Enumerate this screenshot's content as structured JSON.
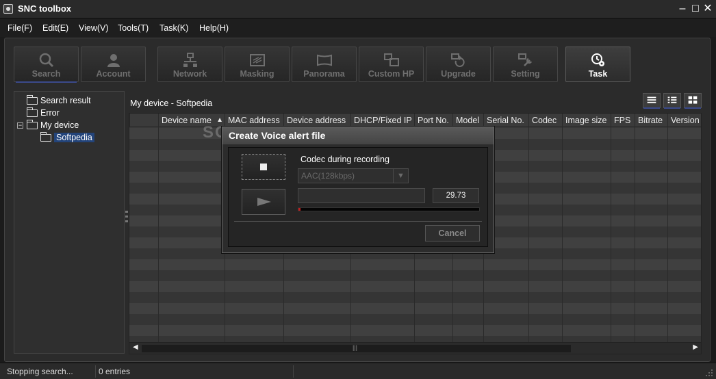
{
  "window": {
    "title": "SNC toolbox"
  },
  "menu": [
    "File(F)",
    "Edit(E)",
    "View(V)",
    "Tools(T)",
    "Task(K)",
    "Help(H)"
  ],
  "toolbar": {
    "search": "Search",
    "account": "Account",
    "network": "Network",
    "masking": "Masking",
    "panorama": "Panorama",
    "custom_hp": "Custom HP",
    "upgrade": "Upgrade",
    "setting": "Setting",
    "task": "Task"
  },
  "tree": {
    "search_result": "Search result",
    "error": "Error",
    "my_device": "My device",
    "softpedia": "Softpedia",
    "expander": "−"
  },
  "list": {
    "title": "My device - Softpedia",
    "columns": [
      "Device name",
      "MAC address",
      "Device address",
      "DHCP/Fixed IP",
      "Port No.",
      "Model",
      "Serial No.",
      "Codec",
      "Image size",
      "FPS",
      "Bitrate",
      "Version N"
    ],
    "sort_indicator": "▲"
  },
  "dialog": {
    "title": "Create Voice alert file",
    "codec_label": "Codec during recording",
    "codec_value": "AAC(128kbps)",
    "duration": "29.73",
    "progress": 0.01,
    "cancel": "Cancel"
  },
  "watermark": "SOFTPEDIA",
  "status": {
    "message": "Stopping search...",
    "entries": "0 entries"
  },
  "colors": {
    "accent": "#3b4a8c",
    "selection": "#23447a",
    "record": "#c02020"
  }
}
